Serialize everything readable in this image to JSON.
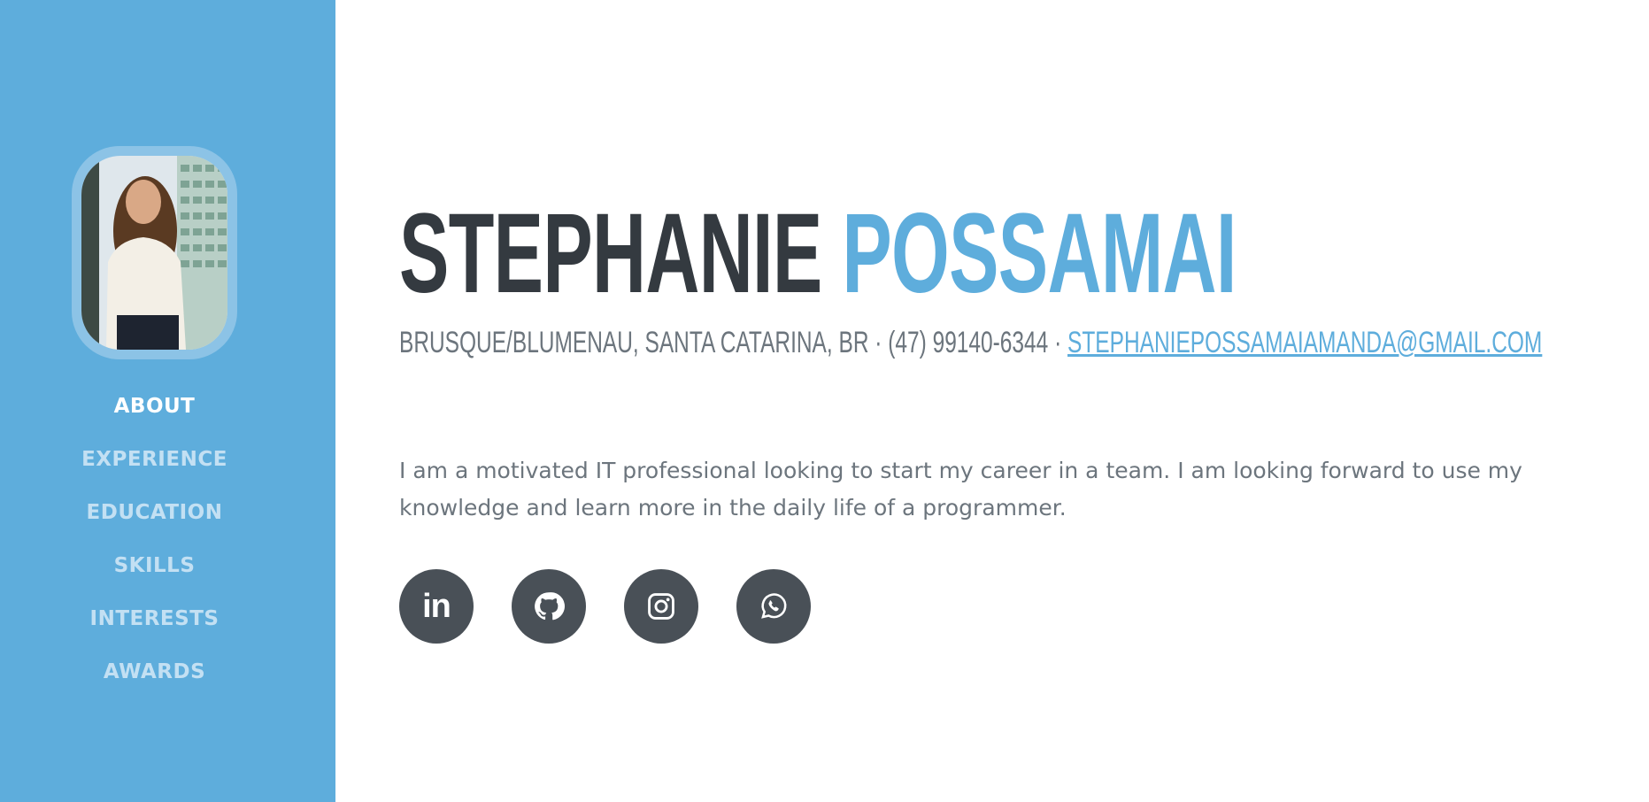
{
  "profile": {
    "first_name": "STEPHANIE",
    "last_name": "POSSAMAI",
    "location_phone": "BRUSQUE/BLUMENAU, SANTA CATARINA, BR · (47) 99140-6344 · ",
    "email": "STEPHANIEPOSSAMAIAMANDA@GMAIL.COM",
    "about": "I am a motivated IT professional looking to start my career in a team. I am looking forward to use my knowledge and learn more in the daily life of a programmer."
  },
  "nav": {
    "items": [
      {
        "label": "ABOUT",
        "active": true
      },
      {
        "label": "EXPERIENCE",
        "active": false
      },
      {
        "label": "EDUCATION",
        "active": false
      },
      {
        "label": "SKILLS",
        "active": false
      },
      {
        "label": "INTERESTS",
        "active": false
      },
      {
        "label": "AWARDS",
        "active": false
      }
    ]
  },
  "socials": {
    "linkedin_label": "in",
    "icons": [
      "linkedin-icon",
      "github-icon",
      "instagram-icon",
      "whatsapp-icon"
    ]
  },
  "colors": {
    "primary": "#5eaddc",
    "dark": "#343a40",
    "muted": "#6c757d",
    "icon_bg": "#495057"
  }
}
